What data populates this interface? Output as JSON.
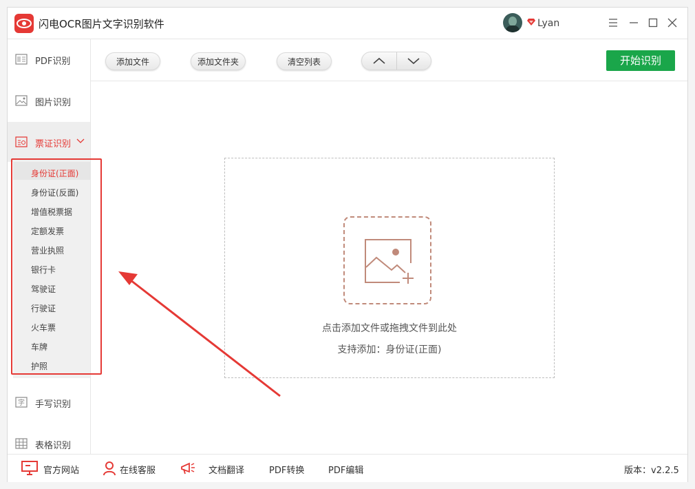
{
  "app": {
    "title": "闪电OCR图片文字识别软件"
  },
  "user": {
    "name": "Lyan"
  },
  "sidebar": {
    "items": [
      {
        "label": "PDF识别",
        "icon": "pdf-icon"
      },
      {
        "label": "图片识别",
        "icon": "image-icon"
      },
      {
        "label": "票证识别",
        "icon": "ticket-icon",
        "active": true
      },
      {
        "label": "手写识别",
        "icon": "handwriting-icon"
      },
      {
        "label": "表格识别",
        "icon": "table-icon"
      }
    ],
    "submenu": [
      "身份证(正面)",
      "身份证(反面)",
      "增值税票据",
      "定额发票",
      "营业执照",
      "银行卡",
      "驾驶证",
      "行驶证",
      "火车票",
      "车牌",
      "护照"
    ]
  },
  "toolbar": {
    "add_file": "添加文件",
    "add_folder": "添加文件夹",
    "clear_list": "清空列表",
    "start": "开始识别"
  },
  "dropzone": {
    "hint": "点击添加文件或拖拽文件到此处",
    "support": "支持添加：身份证(正面)"
  },
  "bottom": {
    "website": "官方网站",
    "support": "在线客服",
    "translate": "文档翻译",
    "pdf_convert": "PDF转换",
    "pdf_edit": "PDF编辑",
    "version": "版本：v2.2.5"
  },
  "colors": {
    "accent": "#e53935",
    "start": "#1aa64a"
  }
}
